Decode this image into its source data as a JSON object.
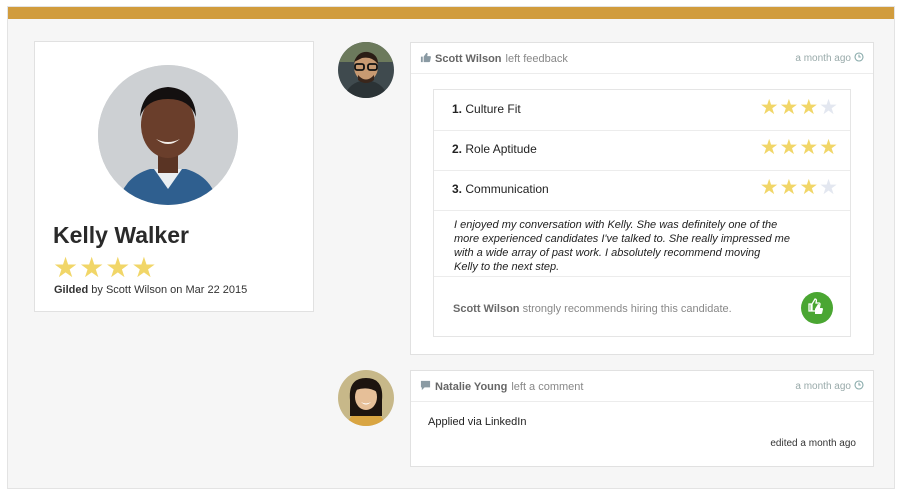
{
  "colors": {
    "top_bar": "#d19c3d",
    "star_filled": "#f1d668",
    "star_empty": "#e3e7f0",
    "recommend_badge": "#4aa632"
  },
  "icons": {
    "feedback": "thumbs-up-icon",
    "comment": "speech-bubble-icon",
    "time": "clock-icon",
    "recommend": "thumbs-up-double-icon"
  },
  "profile": {
    "name": "Kelly Walker",
    "rating": 4,
    "rating_max": 4,
    "gilded_label": "Gilded",
    "gilded_rest": "by Scott Wilson on Mar 22 2015"
  },
  "feedback": {
    "author": "Scott Wilson",
    "action": "left feedback",
    "time": "a month ago",
    "ratings": [
      {
        "number": "1.",
        "label": "Culture Fit",
        "score": 3,
        "max": 4
      },
      {
        "number": "2.",
        "label": "Role Aptitude",
        "score": 4,
        "max": 4
      },
      {
        "number": "3.",
        "label": "Communication",
        "score": 3,
        "max": 4
      }
    ],
    "comment_lines": [
      "I enjoyed my conversation with Kelly. She was definitely one of the",
      "more experienced candidates I've talked to. She really impressed me",
      "with a wide array of past work. I absolutely recommend moving",
      "Kelly to the next step."
    ],
    "recommend_author": "Scott Wilson",
    "recommend_text": "strongly recommends hiring this candidate."
  },
  "comment": {
    "author": "Natalie Young",
    "action": "left a comment",
    "time": "a month ago",
    "body": "Applied via LinkedIn",
    "edited": "edited a month ago"
  }
}
